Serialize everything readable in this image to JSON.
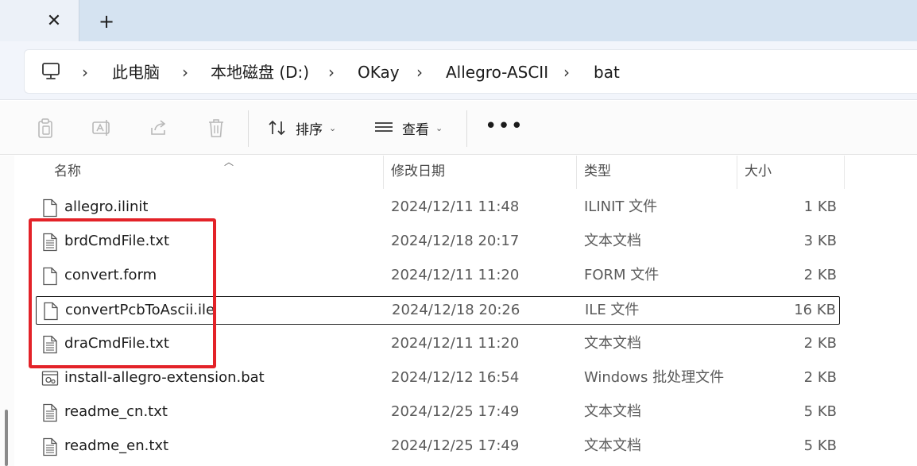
{
  "tabs": {
    "close_glyph": "✕",
    "new_tab_glyph": "+"
  },
  "breadcrumb": [
    {
      "label": "此电脑"
    },
    {
      "label": "本地磁盘 (D:)"
    },
    {
      "label": "OKay"
    },
    {
      "label": "Allegro-ASCII"
    },
    {
      "label": "bat"
    }
  ],
  "breadcrumb_separator": "›",
  "toolbar": {
    "sort_label": "排序",
    "view_label": "查看",
    "more_label": "•••",
    "icons": [
      "copy-icon",
      "rename-icon",
      "share-icon",
      "delete-icon"
    ]
  },
  "columns": {
    "name": "名称",
    "modified": "修改日期",
    "type": "类型",
    "size": "大小"
  },
  "files": [
    {
      "name": "allegro.ilinit",
      "modified": "2024/12/11 11:48",
      "type": "ILINIT 文件",
      "size": "1 KB",
      "icon": "blank-file-icon"
    },
    {
      "name": "brdCmdFile.txt",
      "modified": "2024/12/18 20:17",
      "type": "文本文档",
      "size": "3 KB",
      "icon": "text-file-icon"
    },
    {
      "name": "convert.form",
      "modified": "2024/12/11 11:20",
      "type": "FORM 文件",
      "size": "2 KB",
      "icon": "blank-file-icon"
    },
    {
      "name": "convertPcbToAscii.ile",
      "modified": "2024/12/18 20:26",
      "type": "ILE 文件",
      "size": "16 KB",
      "icon": "blank-file-icon"
    },
    {
      "name": "draCmdFile.txt",
      "modified": "2024/12/11 11:20",
      "type": "文本文档",
      "size": "2 KB",
      "icon": "text-file-icon"
    },
    {
      "name": "install-allegro-extension.bat",
      "modified": "2024/12/12 16:54",
      "type": "Windows 批处理文件",
      "size": "2 KB",
      "icon": "batch-file-icon"
    },
    {
      "name": "readme_cn.txt",
      "modified": "2024/12/25 17:49",
      "type": "文本文档",
      "size": "5 KB",
      "icon": "text-file-icon"
    },
    {
      "name": "readme_en.txt",
      "modified": "2024/12/25 17:49",
      "type": "文本文档",
      "size": "5 KB",
      "icon": "text-file-icon"
    }
  ],
  "focused_file": "convertPcbToAscii.ile",
  "annotation": {
    "color": "#e32228",
    "highlighted_files": [
      "brdCmdFile.txt",
      "convert.form",
      "convertPcbToAscii.ile",
      "draCmdFile.txt"
    ]
  }
}
